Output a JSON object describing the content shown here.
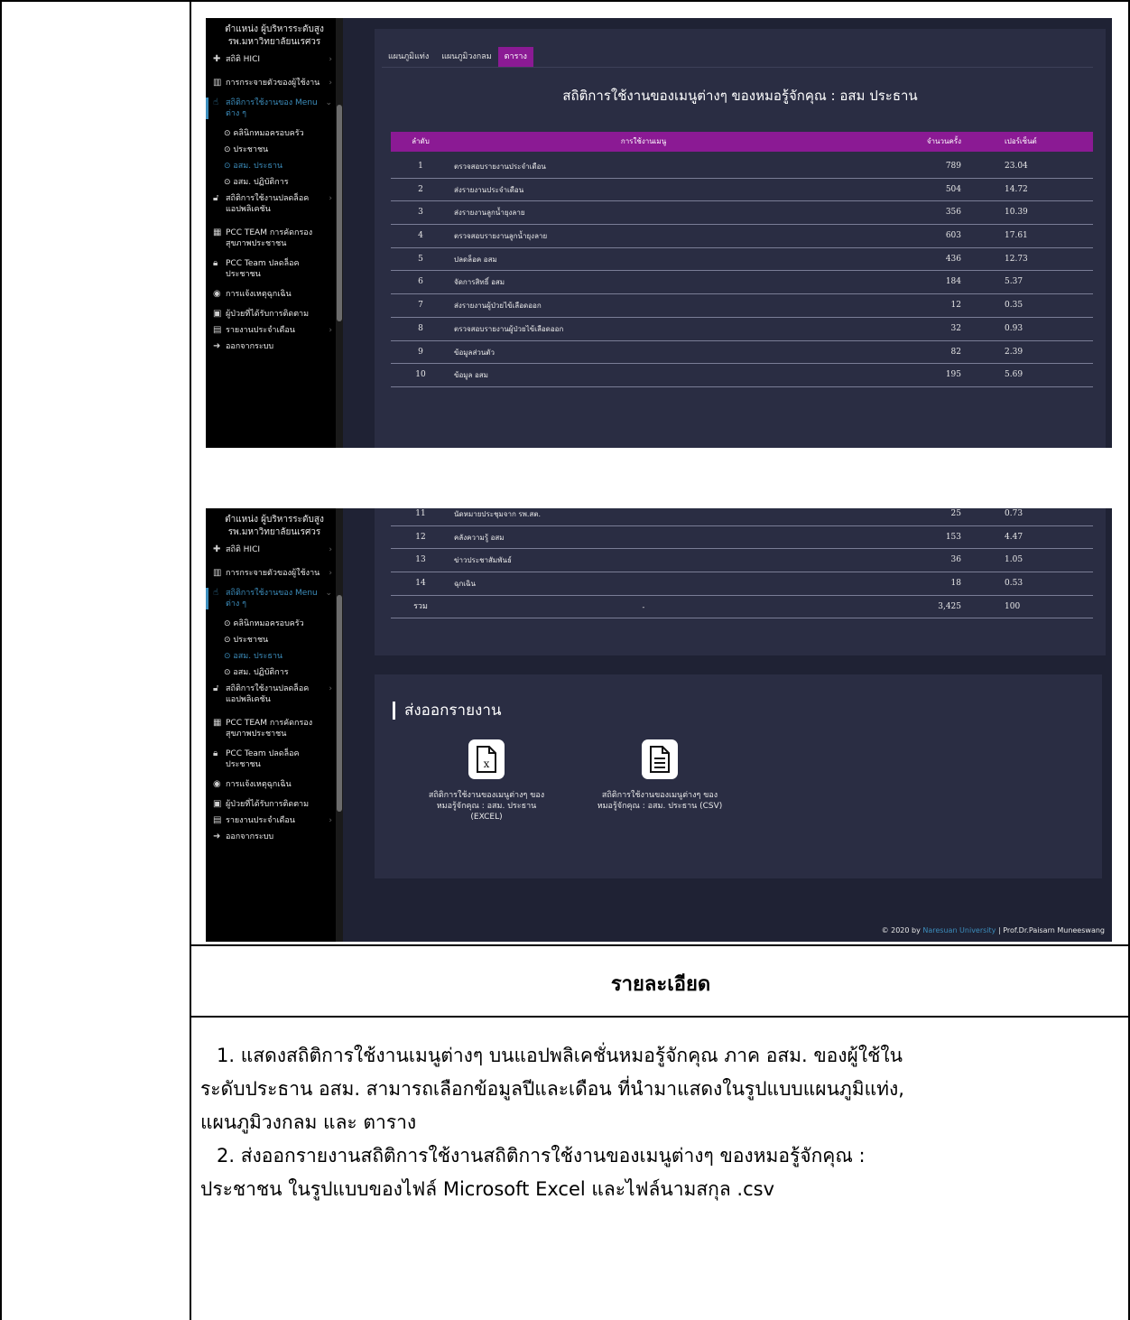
{
  "sidebar": {
    "header": [
      "ตำแหน่ง ผู้บริหารระดับสูง",
      "รพ.มหาวิทยาลัยนเรศวร"
    ],
    "items": [
      {
        "icon": "hospital-icon",
        "label": "สถิติ HICI"
      },
      {
        "icon": "map-icon",
        "label": "การกระจายตัวของผู้ใช้งาน"
      },
      {
        "icon": "pointer-icon",
        "label": "สถิติการใช้งานของ Menu ต่าง ๆ"
      },
      {
        "icon": "unlock-icon",
        "label": "สถิติการใช้งานปลดล็อคแอปพลิเคชัน"
      },
      {
        "icon": "team-icon",
        "label": "PCC TEAM การคัดกรองสุขภาพประชาชน"
      },
      {
        "icon": "lock-icon",
        "label": "PCC Team ปลดล็อคประชาชน"
      },
      {
        "icon": "alert-icon",
        "label": "การแจ้งเหตุฉุกเฉิน"
      },
      {
        "icon": "medkit-icon",
        "label": "ผู้ป่วยที่ได้รับการติดตาม"
      },
      {
        "icon": "report-icon",
        "label": "รายงานประจำเดือน"
      },
      {
        "icon": "logout-icon",
        "label": "ออกจากระบบ"
      }
    ],
    "submenu": [
      "คลินิกหมอครอบครัว",
      "ประชาชน",
      "อสม. ประธาน",
      "อสม. ปฏิบัติการ"
    ]
  },
  "tabs": [
    "แผนภูมิแท่ง",
    "แผนภูมิวงกลม",
    "ตาราง"
  ],
  "table": {
    "title": "สถิติการใช้งานของเมนูต่างๆ ของหมอรู้จักคุณ : อสม ประธาน",
    "headers": [
      "ลำดับ",
      "การใช้งานเมนู",
      "จำนวนครั้ง",
      "เปอร์เซ็นต์"
    ],
    "rows": [
      [
        "1",
        "ตรวจสอบรายงานประจำเดือน",
        "789",
        "23.04"
      ],
      [
        "2",
        "ส่งรายงานประจำเดือน",
        "504",
        "14.72"
      ],
      [
        "3",
        "ส่งรายงานลูกน้ำยุงลาย",
        "356",
        "10.39"
      ],
      [
        "4",
        "ตรวจสอบรายงานลูกน้ำยุงลาย",
        "603",
        "17.61"
      ],
      [
        "5",
        "ปลดล็อค อสม",
        "436",
        "12.73"
      ],
      [
        "6",
        "จัดการสิทธิ์ อสม",
        "184",
        "5.37"
      ],
      [
        "7",
        "ส่งรายงานผู้ป่วยไข้เลือดออก",
        "12",
        "0.35"
      ],
      [
        "8",
        "ตรวจสอบรายงานผู้ป่วยไข้เลือดออก",
        "32",
        "0.93"
      ],
      [
        "9",
        "ข้อมูลส่วนตัว",
        "82",
        "2.39"
      ],
      [
        "10",
        "ข้อมูล อสม",
        "195",
        "5.69"
      ],
      [
        "11",
        "นัดหมายประชุมจาก รพ.สต.",
        "25",
        "0.73"
      ],
      [
        "12",
        "คลังความรู้ อสม",
        "153",
        "4.47"
      ],
      [
        "13",
        "ข่าวประชาสัมพันธ์",
        "36",
        "1.05"
      ],
      [
        "14",
        "ฉุกเฉิน",
        "18",
        "0.53"
      ]
    ],
    "total": [
      "รวม",
      "-",
      "3,425",
      "100"
    ]
  },
  "export": {
    "title": "ส่งออกรายงาน",
    "excel_label": "สถิติการใช้งานของเมนูต่างๆ ของหมอรู้จักคุณ : อสม. ประธาน (EXCEL)",
    "csv_label": "สถิติการใช้งานของเมนูต่างๆ ของหมอรู้จักคุณ : อสม. ประธาน (CSV)"
  },
  "footer": {
    "prefix": "© 2020 by",
    "university": "Naresuan University",
    "suffix": "| Prof.Dr.Paisarn Muneeswang"
  },
  "detail": {
    "heading": "รายละเอียด",
    "p1_lines": [
      "1. แสดงสถิติการใช้งานเมนูต่างๆ บนแอปพลิเคชั่นหมอรู้จักคุณ ภาค อสม. ของผู้ใช้ใน",
      "ระดับประธาน อสม. สามารถเลือกข้อมูลปีและเดือน ที่นำมาแสดงในรูปแบบแผนภูมิแท่ง,",
      "แผนภูมิวงกลม และ ตาราง"
    ],
    "p2_lines": [
      "2. ส่งออกรายงานสถิติการใช้งานสถิติการใช้งานของเมนูต่างๆ ของหมอรู้จักคุณ :",
      "ประชาชน ในรูปแบบของไฟล์ Microsoft Excel และไฟล์นามสกุล .csv"
    ]
  }
}
